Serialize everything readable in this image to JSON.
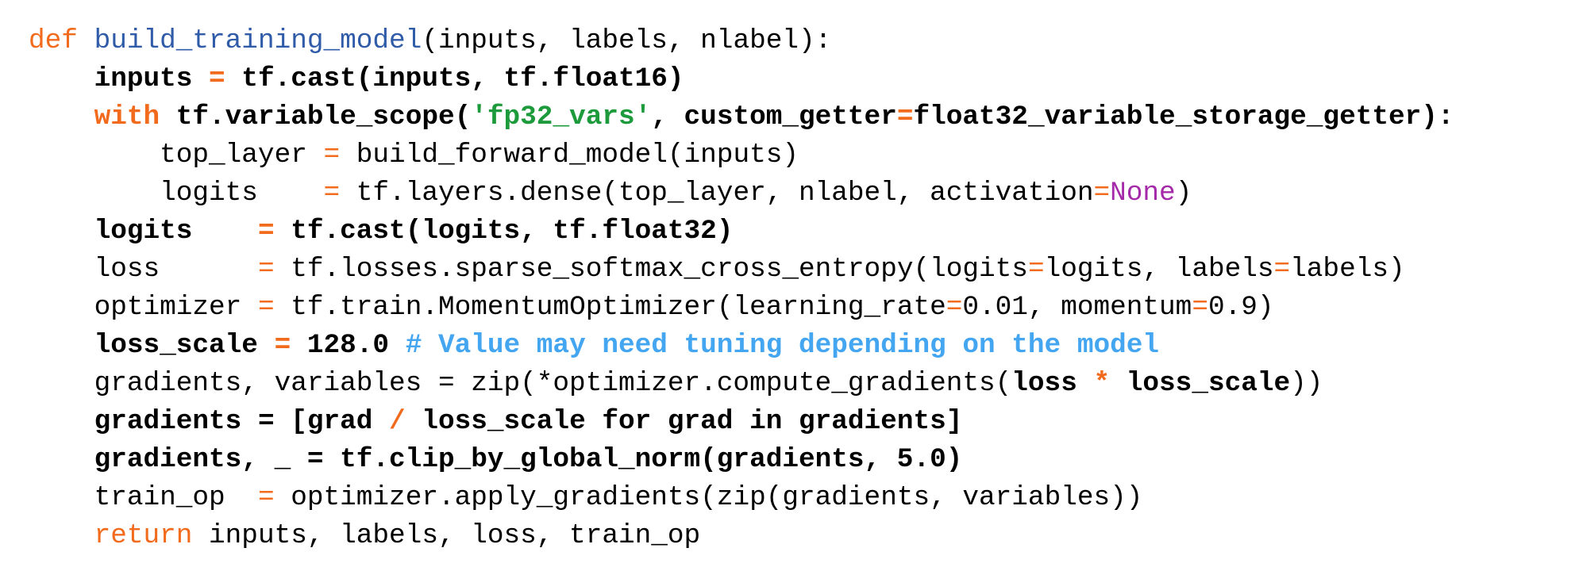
{
  "code_lines": [
    {
      "indent": 0,
      "bold": false,
      "tokens": [
        {
          "text": "def",
          "style": "keyword"
        },
        {
          "text": " ",
          "style": "plain"
        },
        {
          "text": "build_training_model",
          "style": "function"
        },
        {
          "text": "(inputs, labels, nlabel):",
          "style": "plain"
        }
      ]
    },
    {
      "indent": 1,
      "bold": true,
      "tokens": [
        {
          "text": "inputs ",
          "style": "plain"
        },
        {
          "text": "=",
          "style": "keyword"
        },
        {
          "text": " tf.cast(inputs, tf.float16)",
          "style": "plain"
        }
      ]
    },
    {
      "indent": 1,
      "bold": true,
      "tokens": [
        {
          "text": "with",
          "style": "keyword"
        },
        {
          "text": " tf.variable_scope(",
          "style": "plain"
        },
        {
          "text": "'fp32_vars'",
          "style": "string"
        },
        {
          "text": ", custom_getter",
          "style": "plain"
        },
        {
          "text": "=",
          "style": "keyword"
        },
        {
          "text": "float32_variable_storage_getter):",
          "style": "plain"
        }
      ]
    },
    {
      "indent": 2,
      "bold": false,
      "tokens": [
        {
          "text": "top_layer ",
          "style": "plain"
        },
        {
          "text": "=",
          "style": "keyword"
        },
        {
          "text": " build_forward_model(inputs)",
          "style": "plain"
        }
      ]
    },
    {
      "indent": 2,
      "bold": false,
      "tokens": [
        {
          "text": "logits    ",
          "style": "plain"
        },
        {
          "text": "=",
          "style": "keyword"
        },
        {
          "text": " tf.layers.dense(top_layer, nlabel, activation",
          "style": "plain"
        },
        {
          "text": "=",
          "style": "keyword"
        },
        {
          "text": "None",
          "style": "constant"
        },
        {
          "text": ")",
          "style": "plain"
        }
      ]
    },
    {
      "indent": 1,
      "bold": true,
      "tokens": [
        {
          "text": "logits    ",
          "style": "plain"
        },
        {
          "text": "=",
          "style": "keyword"
        },
        {
          "text": " tf.cast(logits, tf.float32)",
          "style": "plain"
        }
      ]
    },
    {
      "indent": 1,
      "bold": false,
      "tokens": [
        {
          "text": "loss      ",
          "style": "plain"
        },
        {
          "text": "=",
          "style": "keyword"
        },
        {
          "text": " tf.losses.sparse_softmax_cross_entropy(logits",
          "style": "plain"
        },
        {
          "text": "=",
          "style": "keyword"
        },
        {
          "text": "logits, labels",
          "style": "plain"
        },
        {
          "text": "=",
          "style": "keyword"
        },
        {
          "text": "labels)",
          "style": "plain"
        }
      ]
    },
    {
      "indent": 1,
      "bold": false,
      "tokens": [
        {
          "text": "optimizer ",
          "style": "plain"
        },
        {
          "text": "=",
          "style": "keyword"
        },
        {
          "text": " tf.train.MomentumOptimizer(learning_rate",
          "style": "plain"
        },
        {
          "text": "=",
          "style": "keyword"
        },
        {
          "text": "0.01, momentum",
          "style": "plain"
        },
        {
          "text": "=",
          "style": "keyword"
        },
        {
          "text": "0.9)",
          "style": "plain"
        }
      ]
    },
    {
      "indent": 1,
      "bold": true,
      "tokens": [
        {
          "text": "loss_scale ",
          "style": "plain"
        },
        {
          "text": "=",
          "style": "keyword"
        },
        {
          "text": " 128.0 ",
          "style": "plain"
        },
        {
          "text": "# Value may need tuning depending on the model",
          "style": "comment"
        }
      ]
    },
    {
      "indent": 1,
      "bold": false,
      "tokens": [
        {
          "text": "gradients, variables = zip(*optimizer.compute_gradients(",
          "style": "plain"
        },
        {
          "text": "loss ",
          "style": "plain",
          "bold": true
        },
        {
          "text": "*",
          "style": "keyword",
          "bold": true
        },
        {
          "text": " loss_scale",
          "style": "plain",
          "bold": true
        },
        {
          "text": "))",
          "style": "plain"
        }
      ]
    },
    {
      "indent": 1,
      "bold": true,
      "tokens": [
        {
          "text": "gradients = [grad ",
          "style": "plain"
        },
        {
          "text": "/",
          "style": "keyword"
        },
        {
          "text": " loss_scale for grad in gradients]",
          "style": "plain"
        }
      ]
    },
    {
      "indent": 1,
      "bold": true,
      "tokens": [
        {
          "text": "gradients, _ = tf.clip_by_global_norm(gradients, 5.0)",
          "style": "plain"
        }
      ]
    },
    {
      "indent": 1,
      "bold": false,
      "tokens": [
        {
          "text": "train_op  ",
          "style": "plain"
        },
        {
          "text": "=",
          "style": "keyword"
        },
        {
          "text": " optimizer.apply_gradients(zip(gradients, variables))",
          "style": "plain"
        }
      ]
    },
    {
      "indent": 1,
      "bold": false,
      "tokens": [
        {
          "text": "return",
          "style": "keyword"
        },
        {
          "text": " inputs, labels, loss, train_op",
          "style": "plain"
        }
      ]
    }
  ],
  "colors": {
    "keyword": "#f26b1d",
    "function": "#2f5ba8",
    "string": "#1d9b3c",
    "constant": "#a52aa9",
    "comment": "#44a6f0",
    "plain": "#000000"
  }
}
